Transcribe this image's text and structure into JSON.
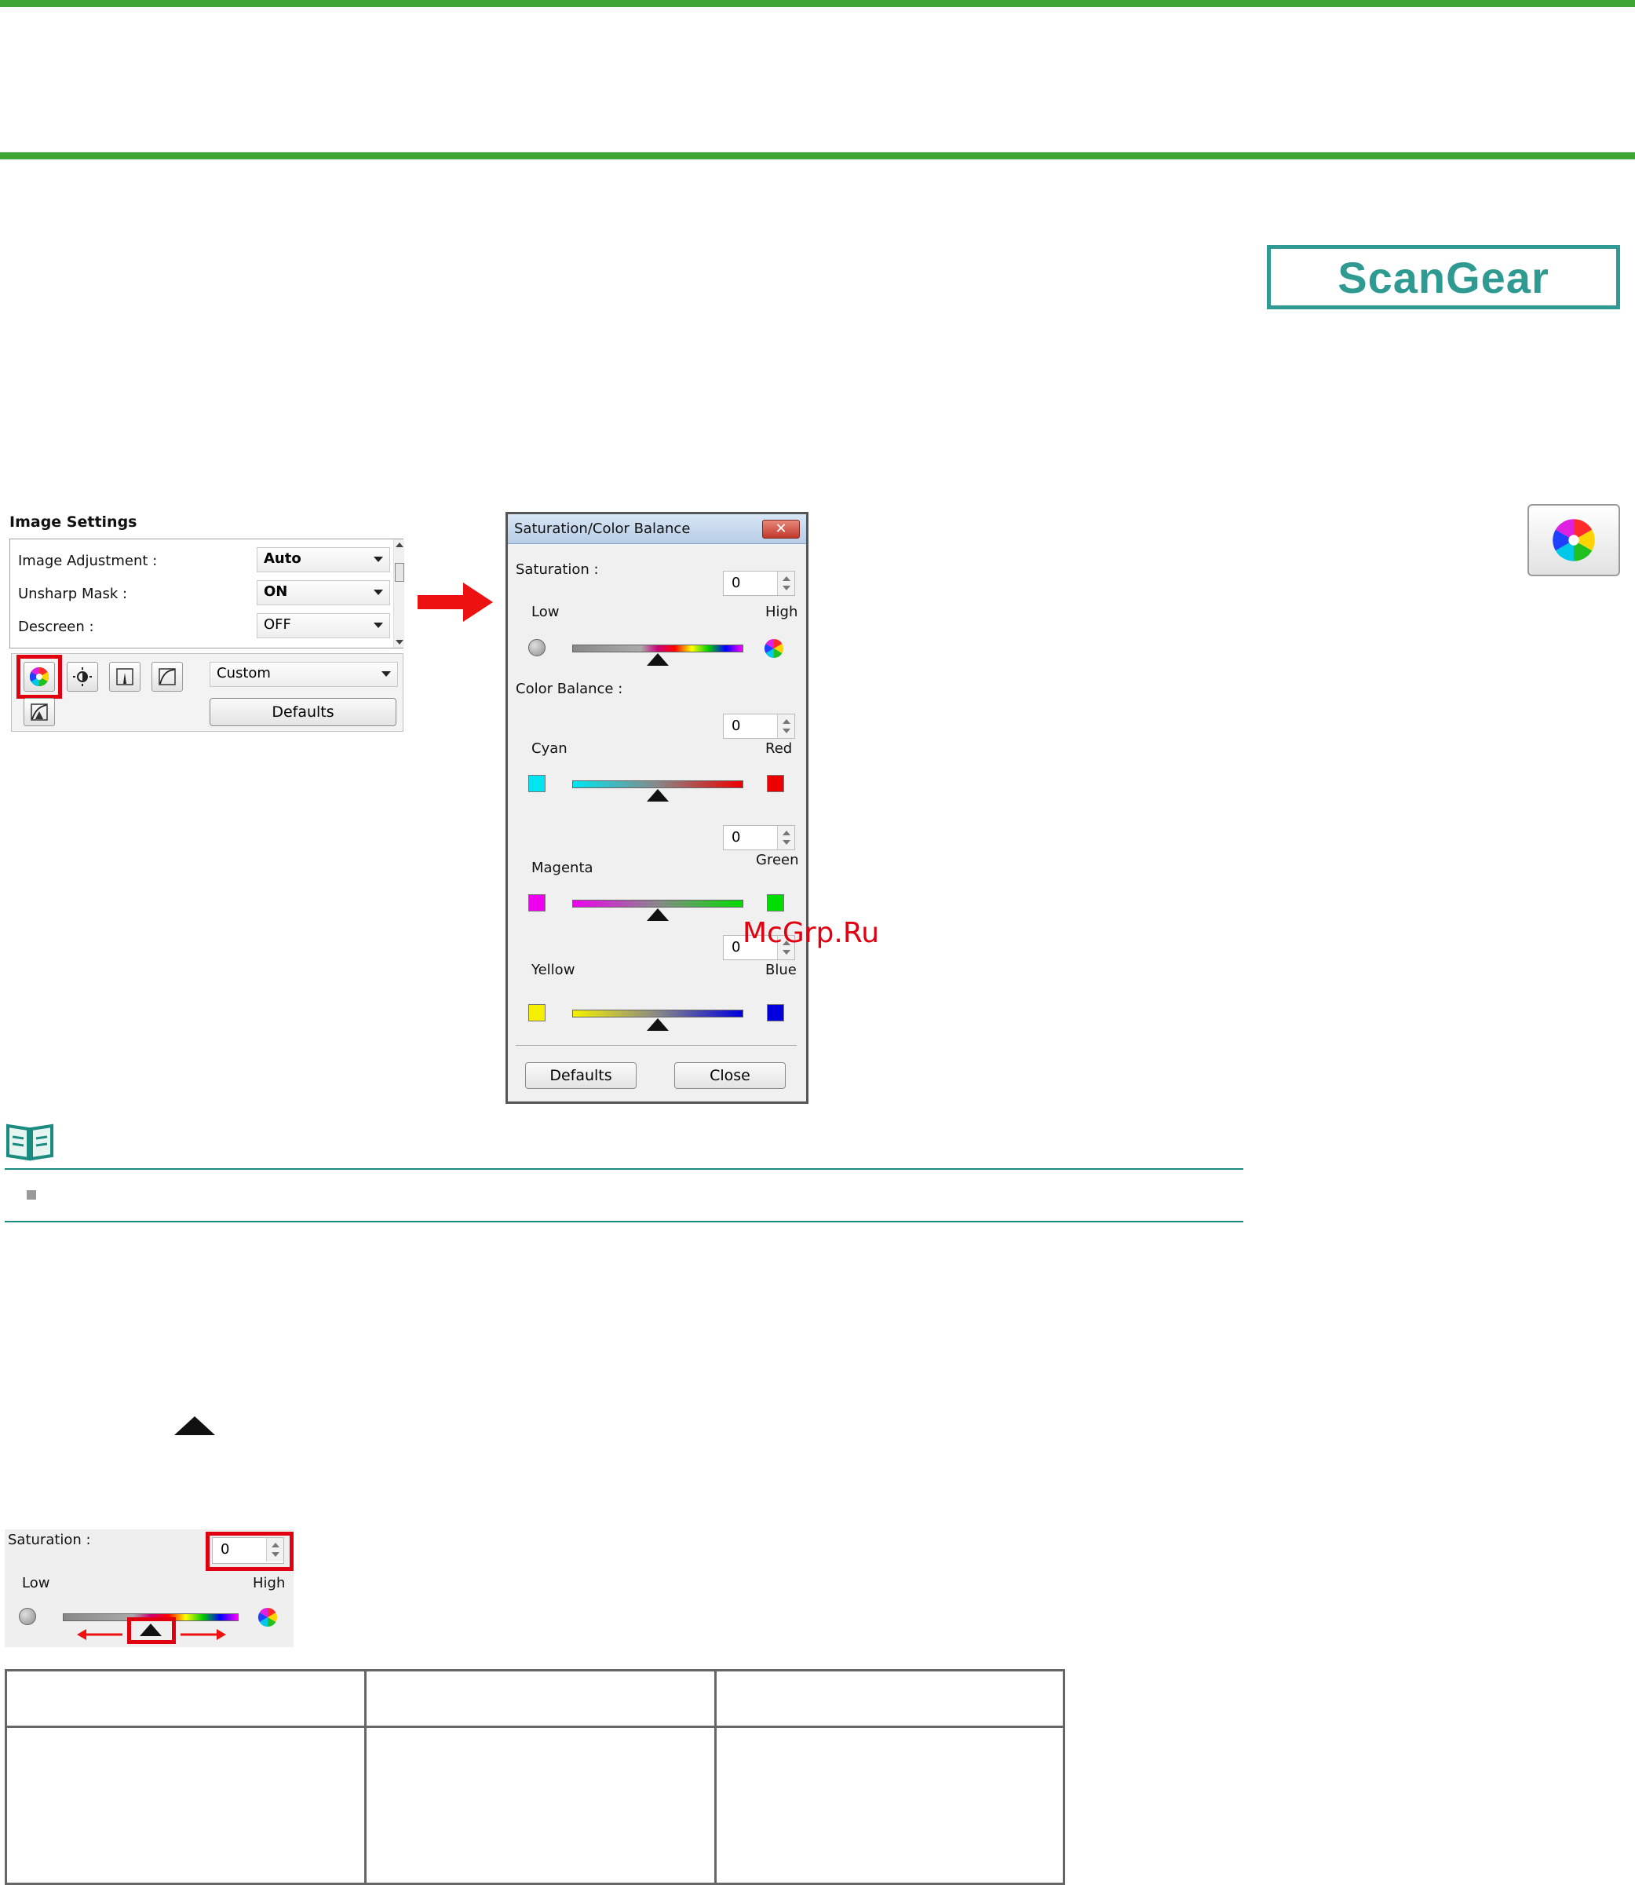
{
  "logo": {
    "text": "ScanGear"
  },
  "image_settings": {
    "title": "Image Settings",
    "rows": [
      {
        "label": "Image Adjustment :",
        "value": "Auto"
      },
      {
        "label": "Unsharp Mask :",
        "value": "ON"
      },
      {
        "label": "Descreen :",
        "value": "OFF"
      }
    ],
    "preset": "Custom",
    "defaults_label": "Defaults"
  },
  "dialog": {
    "title": "Saturation/Color Balance",
    "close_glyph": "✕",
    "saturation_label": "Saturation :",
    "saturation_value": "0",
    "low_label": "Low",
    "high_label": "High",
    "color_balance_label": "Color Balance :",
    "balances": [
      {
        "left": "Cyan",
        "right": "Red",
        "value": "0",
        "left_color": "#00e5f0",
        "right_color": "#ee0000"
      },
      {
        "left": "Magenta",
        "right": "Green",
        "value": "0",
        "left_color": "#ee00ee",
        "right_color": "#00dd00"
      },
      {
        "left": "Yellow",
        "right": "Blue",
        "value": "0",
        "left_color": "#f5f000",
        "right_color": "#0000dd"
      }
    ],
    "defaults_label": "Defaults",
    "close_label": "Close"
  },
  "saturation_detail": {
    "label": "Saturation :",
    "value": "0",
    "low_label": "Low",
    "high_label": "High"
  },
  "watermark": "McGrp.Ru",
  "colors": {
    "green_bar": "#3fa535",
    "teal": "#2f9a92",
    "highlight_red": "#e0000f"
  }
}
